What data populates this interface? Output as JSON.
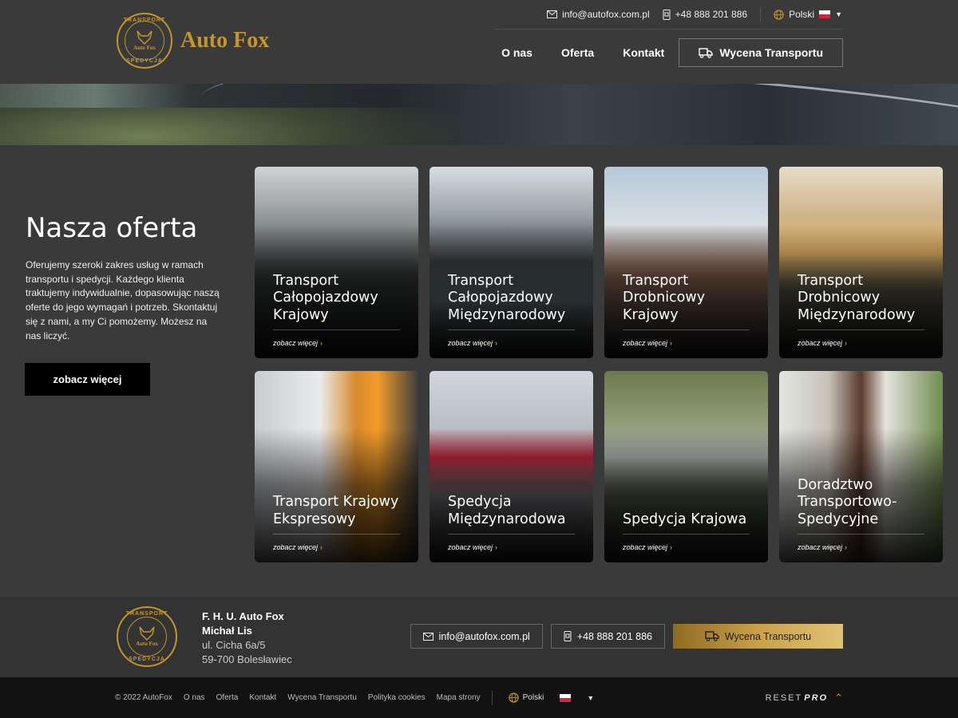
{
  "header": {
    "brand": "Auto Fox",
    "seal_top": "TRANSPORT",
    "seal_bottom": "SPEDYCJA",
    "seal_center": "Auto Fox",
    "email": "info@autofox.com.pl",
    "phone": "+48 888 201 886",
    "language": "Polski",
    "nav": [
      "O nas",
      "Oferta",
      "Kontakt"
    ],
    "cta": "Wycena Transportu"
  },
  "intro": {
    "title": "Nasza oferta",
    "text": "Oferujemy szeroki zakres usług w ramach transportu i spedycji. Każdego klienta traktujemy indywidualnie, dopasowując naszą oferte do jego wymagań i potrzeb. Skontaktuj się z nami, a my Ci pomożemy. Możesz na nas liczyć.",
    "button": "zobacz więcej"
  },
  "offers": [
    {
      "title": "Transport Całopojazdowy Krajowy",
      "more": "zobacz więcej",
      "bg": "linear-gradient(180deg,#cfd3d6 0%,#8a8f90 30%,#3b3f40 55%,#1e2020 100%)"
    },
    {
      "title": "Transport Całopojazdowy Międzynarodowy",
      "more": "zobacz więcej",
      "bg": "linear-gradient(180deg,#d8dde2 0%,#9aa3a8 25%,#3e4244 50%,#6e7e86 70%,#222 100%)"
    },
    {
      "title": "Transport Drobnicowy Krajowy",
      "more": "zobacz więcej",
      "bg": "linear-gradient(180deg,#b7c8da 0%,#d7dee4 30%,#9a6e5a 55%,#6e5a4e 75%,#2a2a2a 100%)"
    },
    {
      "title": "Transport Drobnicowy Międzynarodowy",
      "more": "zobacz więcej",
      "bg": "linear-gradient(180deg,#e7ddc9 0%,#cfb48a 25%,#e6b567 45%,#5c5a4c 65%,#2a2826 100%)"
    },
    {
      "title": "Transport Krajowy Ekspresowy",
      "more": "zobacz więcej",
      "bg": "linear-gradient(90deg,#c9ccd0 0%,#e9eaec 40%,#d88a2c 62%,#f39c2a 75%,#3e3e3e 100%)"
    },
    {
      "title": "Spedycja Międzynarodowa",
      "more": "zobacz więcej",
      "bg": "linear-gradient(180deg,#d2d6db 0%,#b8bec4 30%,#c2273f 45%,#7d8084 65%,#2b2b2b 100%)"
    },
    {
      "title": "Spedycja Krajowa",
      "more": "zobacz więcej",
      "bg": "linear-gradient(180deg,#6a7a4e 0%,#8d9a72 25%,#b2b7b4 45%,#58634c 65%,#242424 100%)"
    },
    {
      "title": "Doradztwo Transportowo-Spedycyjne",
      "more": "zobacz więcej",
      "bg": "linear-gradient(90deg,#e3e5e3 0%,#c8c2b8 30%,#5c3a2c 50%,#e6e2dc 65%,#6e8e4e 100%)"
    }
  ],
  "footer": {
    "company_name": "F. H. U. Auto Fox",
    "owner": "Michał Lis",
    "street": "ul. Cicha 6a/5",
    "city": "59-700 Bolesławiec",
    "email": "info@autofox.com.pl",
    "phone": "+48 888 201 886",
    "cta": "Wycena Transportu"
  },
  "bottom": {
    "copyright": "© 2022 AutoFox",
    "links": [
      "O nas",
      "Oferta",
      "Kontakt",
      "Wycena Transportu",
      "Polityka cookies",
      "Mapa strony"
    ],
    "language": "Polski",
    "credit_a": "RESET",
    "credit_b": "PRO"
  },
  "colors": {
    "accent": "#c4952e",
    "background": "#3a3a3a",
    "footer_bottom": "#121212"
  },
  "icons": [
    "mail-icon",
    "phone-icon",
    "globe-icon",
    "truck-icon",
    "chevron-up-icon"
  ]
}
